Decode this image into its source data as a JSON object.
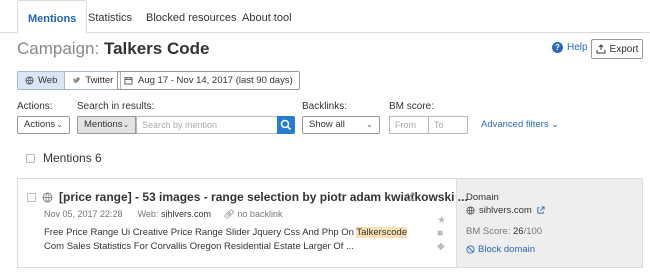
{
  "tabs": [
    {
      "label": "Mentions",
      "active": true
    },
    {
      "label": "Statistics"
    },
    {
      "label": "Blocked resources"
    },
    {
      "label": "About tool"
    }
  ],
  "header": {
    "campaign_prefix": "Campaign:",
    "campaign_name": "Talkers Code",
    "help_label": "Help",
    "export_label": "Export"
  },
  "sources": {
    "web": "Web",
    "twitter": "Twitter"
  },
  "date_range": "Aug 17 - Nov 14, 2017 (last 90 days)",
  "filters": {
    "actions_label": "Actions:",
    "actions_value": "Actions",
    "search_label": "Search in results:",
    "search_scope": "Mentions",
    "search_placeholder": "Search by mention",
    "backlinks_label": "Backlinks:",
    "backlinks_value": "Show all",
    "bm_label": "BM score:",
    "bm_from_placeholder": "From",
    "bm_to_placeholder": "To",
    "advanced": "Advanced filters"
  },
  "mentions_header": "Mentions 6",
  "mention": {
    "title": "[price range] - 53 images - range selection by piotr adam kwiatkowski ...",
    "date": "Nov 05, 2017 22:28",
    "web_label": "Web:",
    "web_value": "sihlvers.com",
    "backlink": "no backlink",
    "snippet_before": "Free Price Range Ui Creative Price Range Slider Jquery Css And Php On ",
    "snippet_highlight": "Talkerscode",
    "snippet_after": " Com Sales Statistics For Corvallis Oregon Residential Estate Larger Of ...",
    "domain_label": "Domain",
    "domain_value": "sihlvers.com",
    "bm_score_label": "BM Score:",
    "bm_score_value": "26",
    "bm_score_max": "/100",
    "block_label": "Block domain"
  },
  "colors": {
    "accent": "#2a69b8",
    "highlight": "#fbe0b5",
    "sidebar": "#eeeeee"
  }
}
